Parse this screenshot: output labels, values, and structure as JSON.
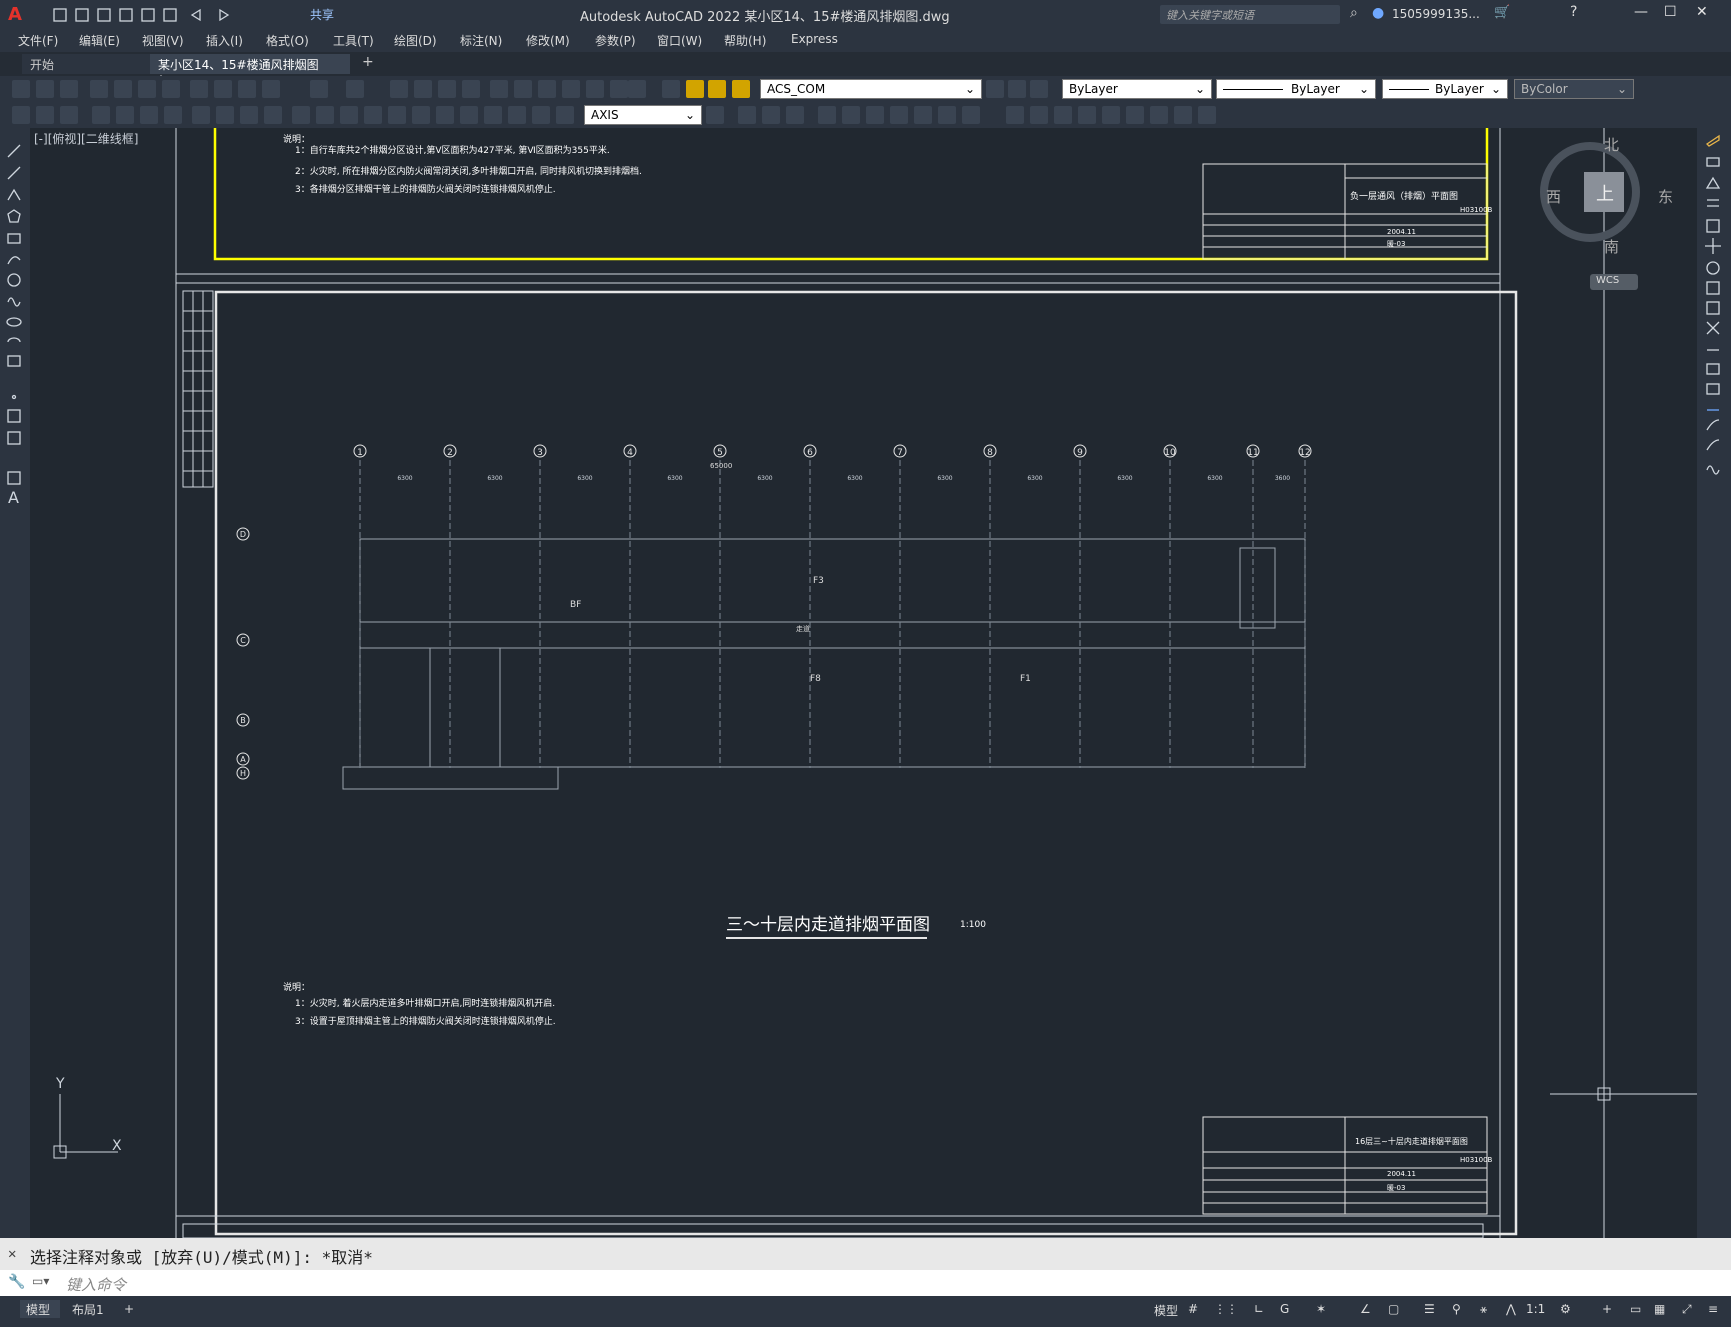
{
  "window": {
    "title": "Autodesk AutoCAD 2022    某小区14、15#楼通风排烟图.dwg",
    "share": "共享",
    "search_placeholder": "键入关键字或短语",
    "user": "1505999135...",
    "close": "✕",
    "min": "—",
    "max": "☐"
  },
  "menu": [
    "文件(F)",
    "编辑(E)",
    "视图(V)",
    "插入(I)",
    "格式(O)",
    "工具(T)",
    "绘图(D)",
    "标注(N)",
    "修改(M)",
    "参数(P)",
    "窗口(W)",
    "帮助(H)",
    "Express"
  ],
  "tabs": [
    {
      "label": "开始"
    },
    {
      "label": "某小区14、15#楼通风排烟图*"
    }
  ],
  "toolbar": {
    "layer": "ACS_COM",
    "color": "ByLayer",
    "linetype": "ByLayer",
    "lineweight": "ByLayer",
    "plotstyle": "ByColor",
    "dimstyle": "AXIS"
  },
  "viewport_label": "[-][俯视][二维线框]",
  "viewcube": {
    "top": "上",
    "north": "北",
    "south": "南",
    "east": "东",
    "west": "西",
    "wcs": "WCS"
  },
  "drawing": {
    "notes_top_title": "说明：",
    "notes_top": [
      "1：自行车库共2个排烟分区设计,第Ⅴ区面积为427平米, 第Ⅵ区面积为355平米.",
      "2：火灾时, 所在排烟分区内防火阀常闭关闭,多叶排烟口开启, 同时排风机切换到排烟档.",
      "3：各排烟分区排烟干管上的排烟防火阀关闭时连锁排烟风机停止."
    ],
    "titleblock_top": "负一层通风（排烟）平面图",
    "titleblock_bottom": "16层三~十层内走道排烟平面图",
    "tb_code": "H03100B",
    "tb_date": "2004.11",
    "tb_no": "暖-03",
    "plan_title": "三～十层内走道排烟平面图",
    "plan_scale": "1:100",
    "notes_bottom_title": "说明：",
    "notes_bottom": [
      "1：火灾时, 着火层内走道多叶排烟口开启,同时连锁排烟风机开启.",
      "3：设置于屋顶排烟主管上的排烟防火阀关闭时连锁排烟风机停止."
    ],
    "axes": [
      "1",
      "2",
      "3",
      "4",
      "5",
      "6",
      "7",
      "8",
      "9",
      "10",
      "11",
      "12"
    ],
    "row_axes": [
      "D",
      "C",
      "B",
      "A",
      "H"
    ],
    "total_dim": "65000",
    "dims": [
      "6300",
      "6300",
      "6300",
      "6300",
      "6300",
      "6300",
      "6300",
      "6300",
      "6300",
      "6300",
      "3600"
    ],
    "labels": {
      "f3": "F3",
      "f8": "F8",
      "f1": "F1",
      "b1": "BF",
      "hall": "走道"
    },
    "ucs_y": "Y",
    "ucs_x": "X"
  },
  "command": {
    "history": "选择注释对象或 [放弃(U)/模式(M)]: *取消*",
    "placeholder": "键入命令"
  },
  "layout_tabs": [
    "模型",
    "布局1"
  ],
  "status": {
    "model": "模型",
    "scale": "1:1"
  }
}
